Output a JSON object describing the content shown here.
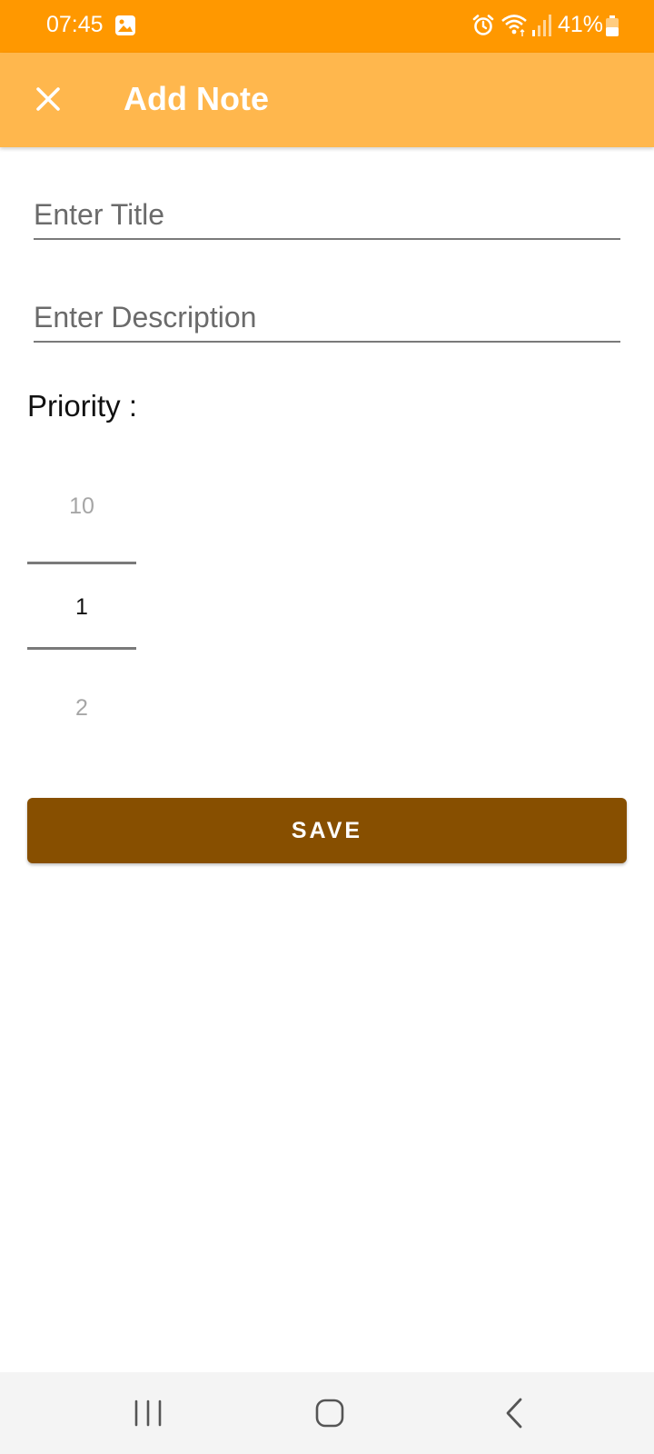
{
  "status_bar": {
    "time": "07:45",
    "battery": "41%",
    "icons": [
      "gallery-icon",
      "alarm-icon",
      "wifi-icon",
      "signal-icon",
      "battery-icon"
    ],
    "background": "#FF9800"
  },
  "app_bar": {
    "title": "Add Note",
    "close_icon": "close-icon",
    "background": "#FFB74D"
  },
  "form": {
    "title_placeholder": "Enter Title",
    "title_value": "",
    "description_placeholder": "Enter Description",
    "description_value": "",
    "priority_label": "Priority :",
    "priority_picker": {
      "previous": "10",
      "current": "1",
      "next": "2"
    },
    "save_label": "SAVE",
    "save_color": "#874F00"
  },
  "nav_bar": {
    "icons": [
      "recent-apps-icon",
      "home-icon",
      "back-icon"
    ]
  }
}
